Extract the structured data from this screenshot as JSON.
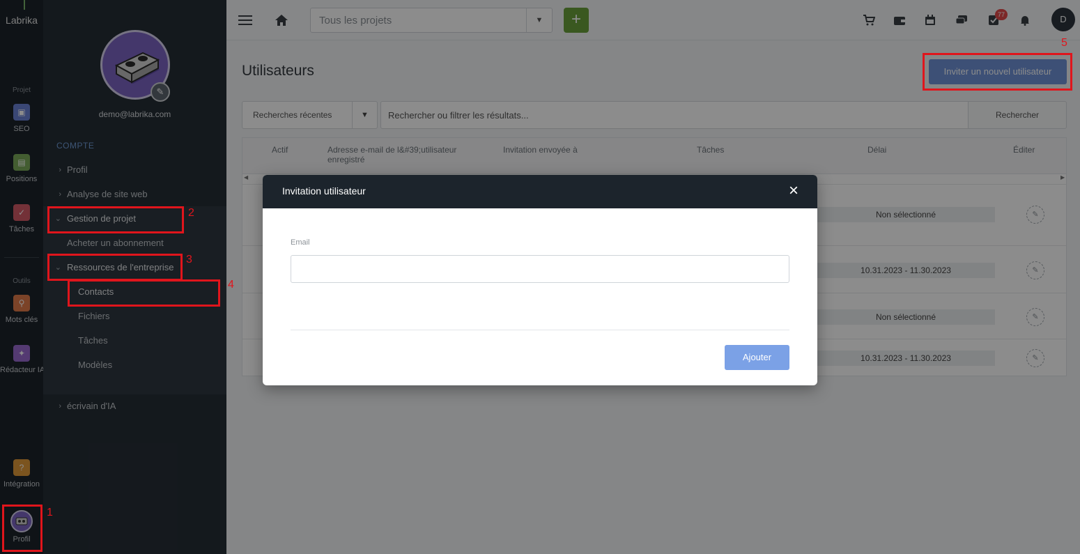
{
  "app": {
    "logo": "Labrika"
  },
  "rail": {
    "section_project": "Projet",
    "section_tools": "Outils",
    "items": [
      {
        "label": "SEO",
        "icon": "seo-icon",
        "color": "#6b82d6"
      },
      {
        "label": "Positions",
        "icon": "positions-icon",
        "color": "#7aaa5a"
      },
      {
        "label": "Tâches",
        "icon": "tasks-icon",
        "color": "#d25a67"
      },
      {
        "label": "Mots clés",
        "icon": "keywords-icon",
        "color": "#e07a4a"
      },
      {
        "label": "Rédacteur IA",
        "icon": "ai-writer-icon",
        "color": "#9a6ad0"
      },
      {
        "label": "Intégration",
        "icon": "integration-icon",
        "color": "#e09a3a"
      },
      {
        "label": "Profil",
        "icon": "profile-avatar-icon",
        "color": "#7c64c4"
      }
    ]
  },
  "sidebar": {
    "email": "demo@labrika.com",
    "heading": "COMPTE",
    "items": [
      {
        "label": "Profil",
        "chevron": "›"
      },
      {
        "label": "Analyse de site web",
        "chevron": "›"
      },
      {
        "label": "Gestion de projet",
        "chevron": "⌄"
      },
      {
        "label": "Acheter un abonnement"
      },
      {
        "label": "Ressources de l'entreprise",
        "chevron": "⌄"
      },
      {
        "label": "Contacts"
      },
      {
        "label": "Fichiers"
      },
      {
        "label": "Tâches"
      },
      {
        "label": "Modèles"
      },
      {
        "label": "écrivain d'IA",
        "chevron": "›"
      }
    ]
  },
  "topbar": {
    "project_select": "Tous les projets",
    "add_symbol": "+",
    "notification_count": "77",
    "user_initial": "D"
  },
  "main": {
    "title": "Utilisateurs",
    "invite_button": "Inviter un nouvel utilisateur",
    "recent_searches": "Recherches récentes",
    "filter_placeholder": "Rechercher ou filtrer les résultats...",
    "search_button": "Rechercher",
    "columns": [
      "Actif",
      "Adresse e-mail de l&#39;utilisateur enregistré",
      "Invitation envoyée à",
      "Tâches",
      "Délai",
      "Éditer"
    ],
    "rows": [
      {
        "delay": "Non sélectionné"
      },
      {
        "delay": "10.31.2023 - 11.30.2023"
      },
      {
        "delay": "Non sélectionné"
      },
      {
        "delay": "10.31.2023 - 11.30.2023"
      }
    ]
  },
  "modal": {
    "title": "Invitation utilisateur",
    "close": "×",
    "email_label": "Email",
    "email_value": "",
    "submit": "Ajouter"
  },
  "annotations": [
    "1",
    "2",
    "3",
    "4",
    "5"
  ],
  "colors": {
    "annotation": "#e0151c",
    "accent": "#6f92d8",
    "add_green": "#6aa03b"
  }
}
